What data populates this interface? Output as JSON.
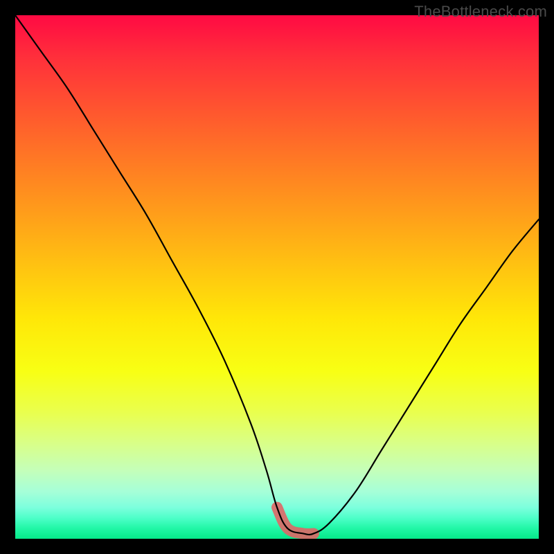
{
  "watermark": "TheBottleneck.com",
  "chart_data": {
    "type": "line",
    "title": "",
    "xlabel": "",
    "ylabel": "",
    "xlim": [
      0,
      100
    ],
    "ylim": [
      0,
      100
    ],
    "grid": false,
    "legend": false,
    "series": [
      {
        "name": "curve",
        "x": [
          0,
          5,
          10,
          15,
          20,
          25,
          30,
          35,
          40,
          45,
          48,
          50,
          52,
          55,
          57,
          60,
          65,
          70,
          75,
          80,
          85,
          90,
          95,
          100
        ],
        "y": [
          100,
          93,
          86,
          78,
          70,
          62,
          53,
          44,
          34,
          22,
          13,
          6,
          2,
          1,
          1,
          3,
          9,
          17,
          25,
          33,
          41,
          48,
          55,
          61
        ]
      }
    ],
    "optimal_band": {
      "name": "optimal-range",
      "x": [
        50,
        52,
        55,
        57
      ],
      "y": [
        6,
        2,
        1,
        1
      ]
    },
    "background_gradient": {
      "top": "#ff0a43",
      "mid": "#ffe708",
      "bottom": "#05e98a"
    }
  }
}
